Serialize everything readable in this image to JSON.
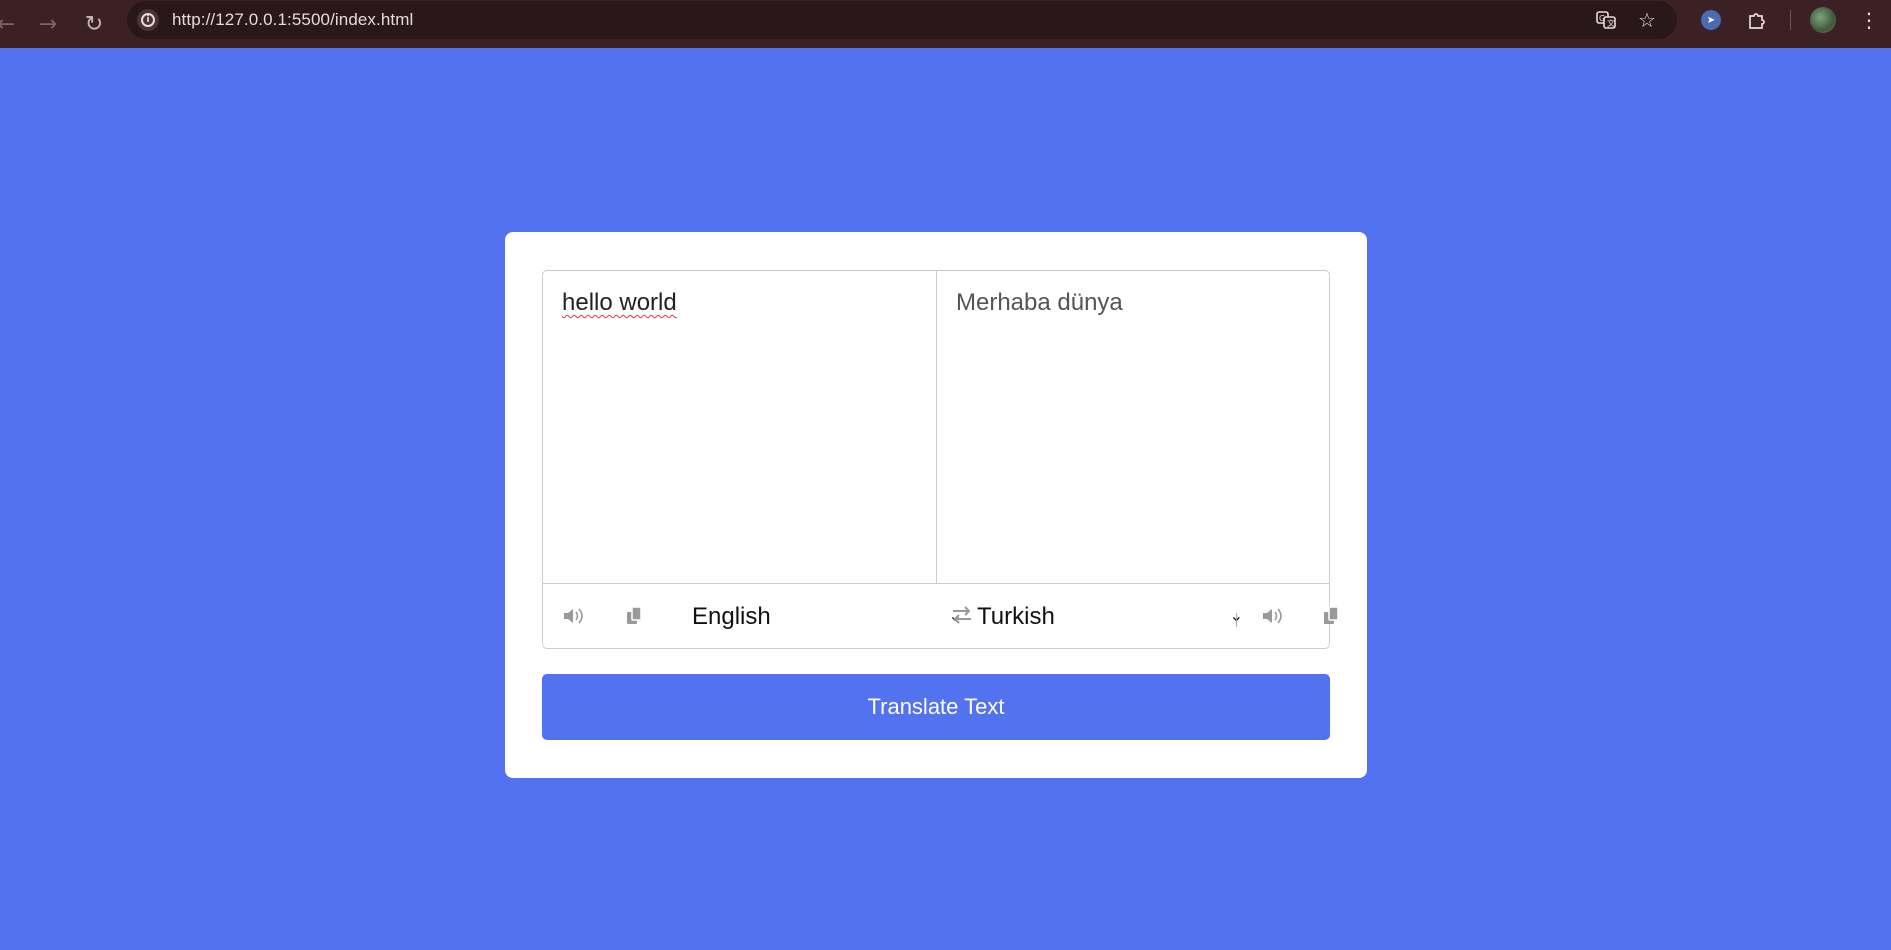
{
  "browser": {
    "url": "http://127.0.0.1:5500/index.html",
    "icons": {
      "back": "back-arrow-icon",
      "forward": "forward-arrow-icon",
      "reload": "reload-icon",
      "site_info": "info-icon",
      "translate": "translate-icon",
      "bookmark": "star-icon",
      "extension": "cursor-extension-icon",
      "extensions_menu": "puzzle-icon",
      "profile": "avatar",
      "menu": "kebab-menu-icon"
    }
  },
  "translator": {
    "from_text": "hello world",
    "to_text": "Merhaba dünya",
    "from_language": "English",
    "to_language": "Turkish",
    "translate_button": "Translate Text",
    "colors": {
      "background": "#5372F0",
      "button": "#5372F0",
      "card": "#FFFFFF",
      "icon": "#999999"
    }
  }
}
